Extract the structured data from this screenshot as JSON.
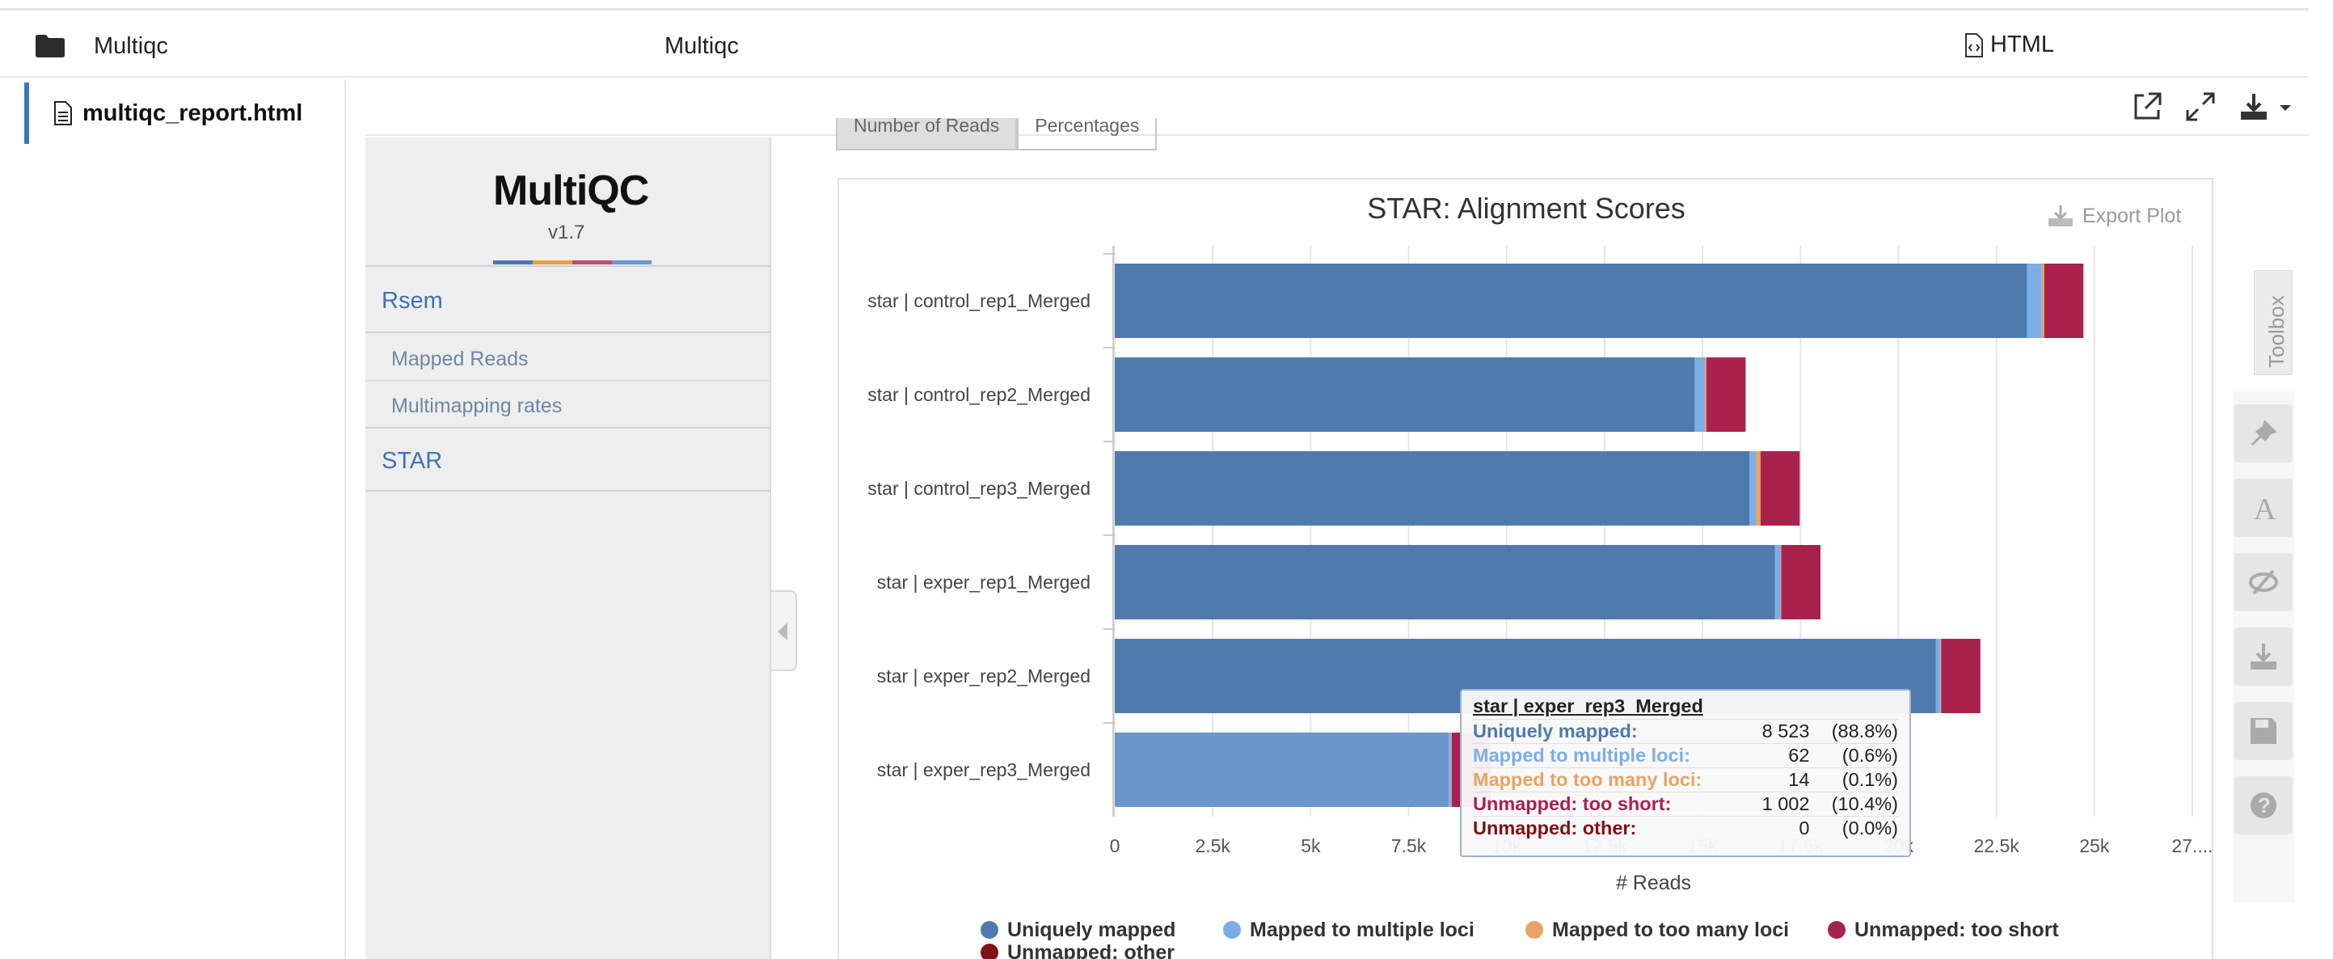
{
  "topbar": {
    "breadcrumb": "Multiqc",
    "title": "Multiqc",
    "file_type": "HTML"
  },
  "file_panel": {
    "file_name": "multiqc_report.html"
  },
  "report": {
    "logo": "MultiQC",
    "version": "v1.7",
    "nav": {
      "section_1": "Rsem",
      "sub_1": "Mapped Reads",
      "sub_2": "Multimapping rates",
      "section_2": "STAR"
    },
    "tabs": [
      "Number of Reads",
      "Percentages"
    ],
    "export_label": "Export Plot",
    "toolbox_label": "Toolbox"
  },
  "colors": {
    "uniquely_mapped": "#4f7aae",
    "mapped_multiple": "#7caee6",
    "mapped_too_many": "#e8a364",
    "unmapped_short": "#a8224d",
    "unmapped_other": "#7f1215",
    "accent": "#3c74b5"
  },
  "chart_data": {
    "type": "bar",
    "orientation": "horizontal",
    "stacked": true,
    "title": "STAR: Alignment Scores",
    "xlabel": "# Reads",
    "ylabel": "",
    "xlim": [
      0,
      27500
    ],
    "x_ticks": [
      "0",
      "2.5k",
      "5k",
      "7.5k",
      "10k",
      "12.5k",
      "15k",
      "17.5k",
      "20k",
      "22.5k",
      "25k",
      "27...."
    ],
    "grid": true,
    "legend_position": "bottom",
    "categories": [
      "star | control_rep1_Merged",
      "star | control_rep2_Merged",
      "star | control_rep3_Merged",
      "star | exper_rep1_Merged",
      "star | exper_rep2_Merged",
      "star | exper_rep3_Merged"
    ],
    "series": [
      {
        "name": "Uniquely mapped",
        "values": [
          23280,
          14800,
          16200,
          16850,
          20950,
          8523
        ]
      },
      {
        "name": "Mapped to multiple loci",
        "values": [
          380,
          260,
          160,
          140,
          120,
          62
        ]
      },
      {
        "name": "Mapped to too many loci",
        "values": [
          60,
          40,
          120,
          20,
          20,
          14
        ]
      },
      {
        "name": "Unmapped: too short",
        "values": [
          1000,
          1000,
          1000,
          1000,
          1000,
          1002
        ]
      },
      {
        "name": "Unmapped: other",
        "values": [
          0,
          0,
          0,
          0,
          0,
          0
        ]
      }
    ]
  },
  "tooltip": {
    "title": "star | exper_rep3_Merged",
    "rows": [
      {
        "name": "Uniquely mapped:",
        "value": "8 523",
        "pct": "(88.8%)"
      },
      {
        "name": "Mapped to multiple loci:",
        "value": "62",
        "pct": "(0.6%)"
      },
      {
        "name": "Mapped to too many loci:",
        "value": "14",
        "pct": "(0.1%)"
      },
      {
        "name": "Unmapped: too short:",
        "value": "1 002",
        "pct": "(10.4%)"
      },
      {
        "name": "Unmapped: other:",
        "value": "0",
        "pct": "(0.0%)"
      }
    ]
  }
}
